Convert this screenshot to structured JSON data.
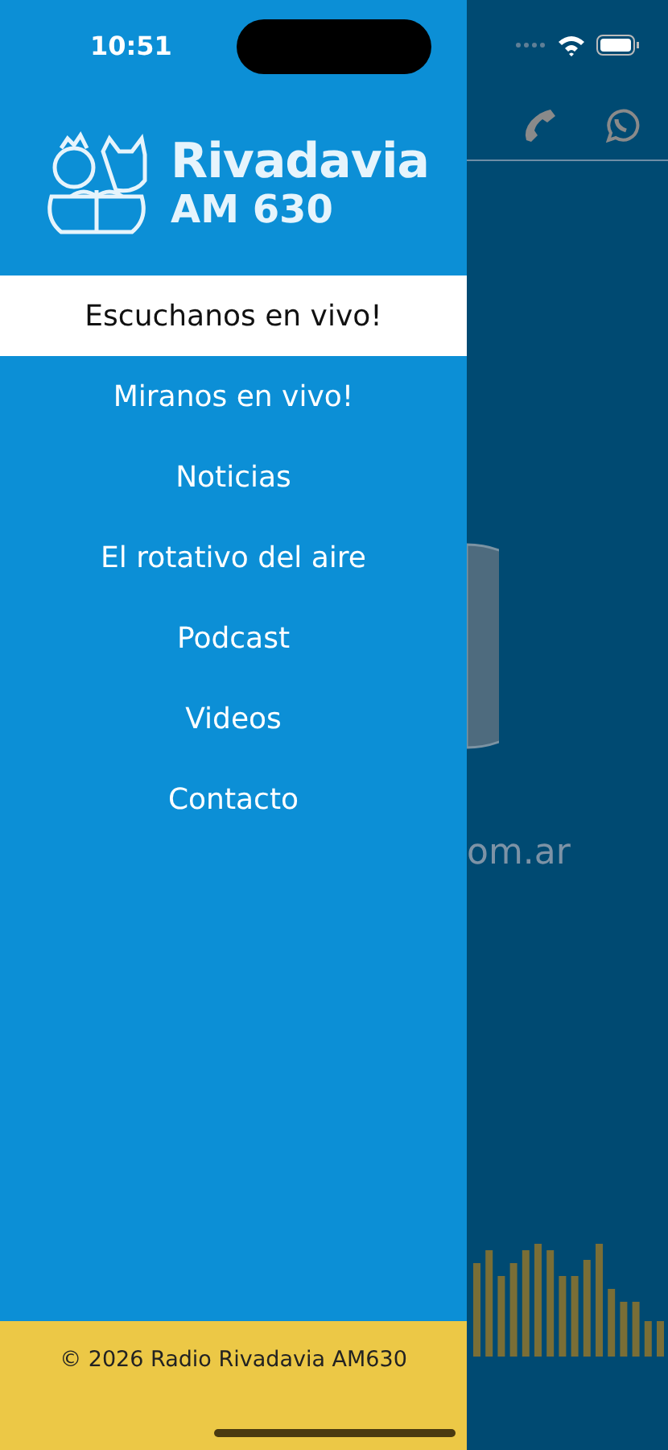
{
  "status_bar": {
    "time": "10:51"
  },
  "logo": {
    "name": "Rivadavia",
    "station": "AM 630"
  },
  "menu": [
    {
      "label": "Escuchanos en vivo!",
      "selected": true
    },
    {
      "label": "Miranos en vivo!",
      "selected": false
    },
    {
      "label": "Noticias",
      "selected": false
    },
    {
      "label": "El rotativo del aire",
      "selected": false
    },
    {
      "label": "Podcast",
      "selected": false
    },
    {
      "label": "Videos",
      "selected": false
    },
    {
      "label": "Contacto",
      "selected": false
    }
  ],
  "footer": {
    "text": "© 2026 Radio Rivadavia AM630"
  },
  "background": {
    "website": "om.ar"
  }
}
